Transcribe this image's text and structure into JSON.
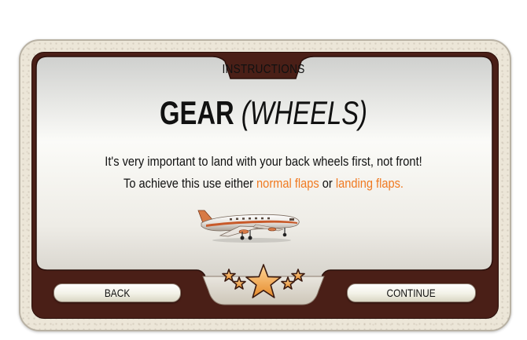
{
  "panel": {
    "title": "INSTRUCTIONS",
    "heading_main": "GEAR",
    "heading_sub": "(WHEELS)",
    "line1": "It's very important to land with your back wheels first, not front!",
    "line2_prefix": "To achieve this use either ",
    "line2_link1": "normal flaps",
    "line2_middle": " or ",
    "line2_link2": "landing flaps."
  },
  "buttons": {
    "back_label": "BACK",
    "continue_label": "CONTINUE"
  },
  "icons": {
    "plane": "airplane-icon",
    "rating": "stars-rating-icon"
  },
  "colors": {
    "frame": "#ece6d8",
    "inner_border": "#4a1f17",
    "highlight": "#f07a22",
    "star": "#f2a33a"
  }
}
